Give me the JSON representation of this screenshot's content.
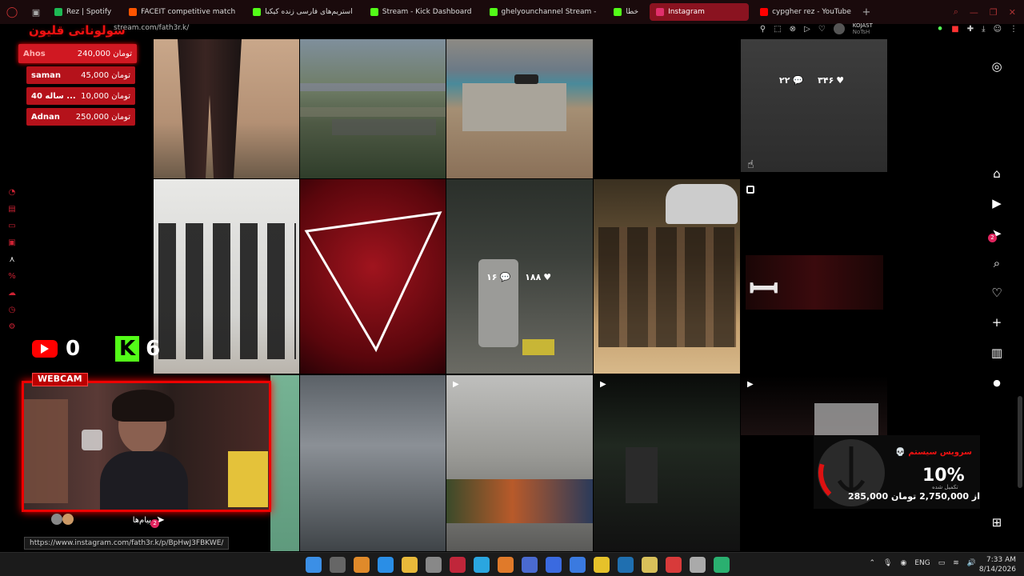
{
  "browser": {
    "tabs": [
      {
        "label": "Rez | Spotify",
        "color": "#1db954",
        "active": false
      },
      {
        "label": "FACEIT competitive match",
        "color": "#ff5500",
        "active": false
      },
      {
        "label": "استریم‌های فارسی زنده کیکبا",
        "color": "#53fc18",
        "active": false
      },
      {
        "label": "Stream - Kick Dashboard",
        "color": "#53fc18",
        "active": false
      },
      {
        "label": "ghelyounchannel Stream -",
        "color": "#53fc18",
        "active": false
      },
      {
        "label": "خطا",
        "color": "#53fc18",
        "active": false
      },
      {
        "label": "Instagram",
        "color": "#e1306c",
        "active": true
      },
      {
        "label": "cypgher rez - YouTube",
        "color": "#ff0000",
        "active": false
      }
    ],
    "new_tab": "+",
    "url": "stream.com/fath3r.k/",
    "profile_name": "KOJAST",
    "profile_sub": "NoTsH",
    "status_url": "https://www.instagram.com/fath3r.k/p/BpHwJ3FBKWE/"
  },
  "overlay": {
    "donation_title": "سولوناتی قلیون",
    "donations": [
      {
        "name": "Ahos",
        "amount": "240,000 تومان",
        "top": true
      },
      {
        "name": "saman",
        "amount": "45,000 تومان",
        "top": false
      },
      {
        "name": "40 ساله ...",
        "amount": "10,000 تومان",
        "top": false
      },
      {
        "name": "Adnan",
        "amount": "250,000 تومان",
        "top": false
      }
    ],
    "youtube_count": "0",
    "kick_count": "6",
    "webcam_label": "WEBCAM",
    "messages_label": "پیام‌ها",
    "messages_badge": "2",
    "goal": {
      "title": "سرویس سیستم",
      "percent": "10%",
      "subtitle": "تکمیل شده",
      "amount": "285,000 از 2,750,000 تومان",
      "progress": 0.1
    }
  },
  "instagram": {
    "post_stats": [
      {
        "likes": "۳۴۶",
        "comments": "۲۲"
      },
      {
        "likes": "۱۸۸",
        "comments": "۱۶"
      }
    ],
    "nav_badge": "2"
  },
  "taskbar": {
    "lang": "ENG",
    "time": "7:33 AM",
    "date": "8/14/2026"
  }
}
